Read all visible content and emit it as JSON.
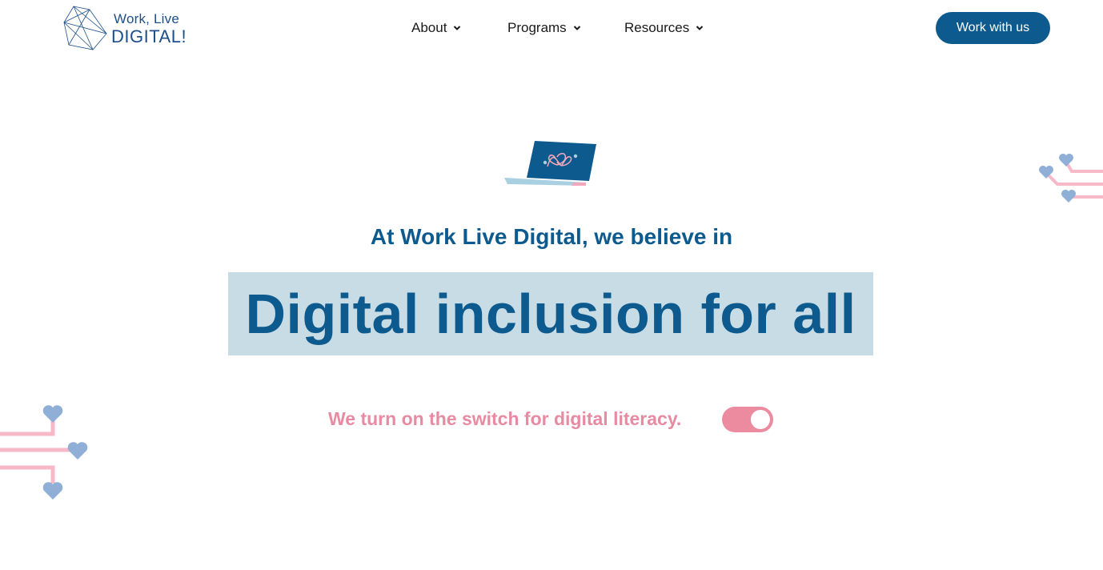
{
  "header": {
    "logo": {
      "line1": "Work, Live",
      "line2": "DIGITAL!",
      "icon": "geometric-crystal-logo-icon"
    },
    "nav": [
      {
        "label": "About",
        "icon": "chevron-down-icon"
      },
      {
        "label": "Programs",
        "icon": "chevron-down-icon"
      },
      {
        "label": "Resources",
        "icon": "chevron-down-icon"
      }
    ],
    "cta_label": "Work with us"
  },
  "hero": {
    "illustration": "laptop-heart-icon",
    "kicker": "At Work Live Digital, we believe in",
    "headline": "Digital inclusion for all",
    "tagline": "We turn on the switch for digital literacy.",
    "toggle_state": "on"
  },
  "decorations": {
    "left": "heart-circuit-icon",
    "right": "heart-circuit-icon"
  },
  "colors": {
    "brand_blue": "#0d5a8f",
    "highlight": "#c8dce6",
    "pink": "#ec8aa0",
    "heart_blue": "#8fafd6",
    "line_pink": "#f7b8c8"
  }
}
